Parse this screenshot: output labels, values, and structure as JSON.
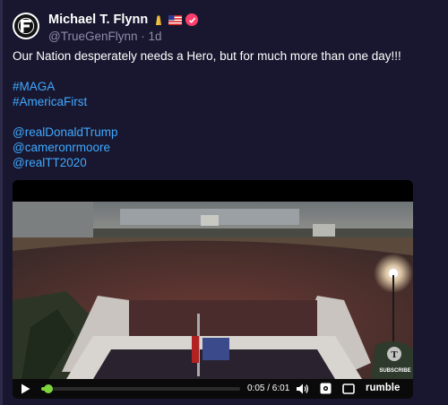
{
  "author": {
    "name": "Michael T. Flynn",
    "name_emojis": [
      "pray-icon",
      "us-flag-icon"
    ],
    "handle": "@TrueGenFlynn",
    "separator": "·",
    "age": "1d",
    "avatar_letters": "F"
  },
  "post": {
    "text": "Our Nation desperately needs a Hero, but for much more than one day!!!",
    "hashtags": [
      "#MAGA",
      "#AmericaFirst"
    ],
    "mentions": [
      "@realDonaldTrump",
      "@cameronrmoore",
      "@realTT2020"
    ]
  },
  "video": {
    "time_display": "0:05 / 6:01",
    "progress_fraction": 0.014,
    "watermark": "SUBSCRIBE",
    "brand_label": "rumble"
  },
  "colors": {
    "background": "#19172f",
    "link": "#3fa9ff",
    "verified_badge": "#ff3d6b",
    "progress": "#7fd63c"
  }
}
